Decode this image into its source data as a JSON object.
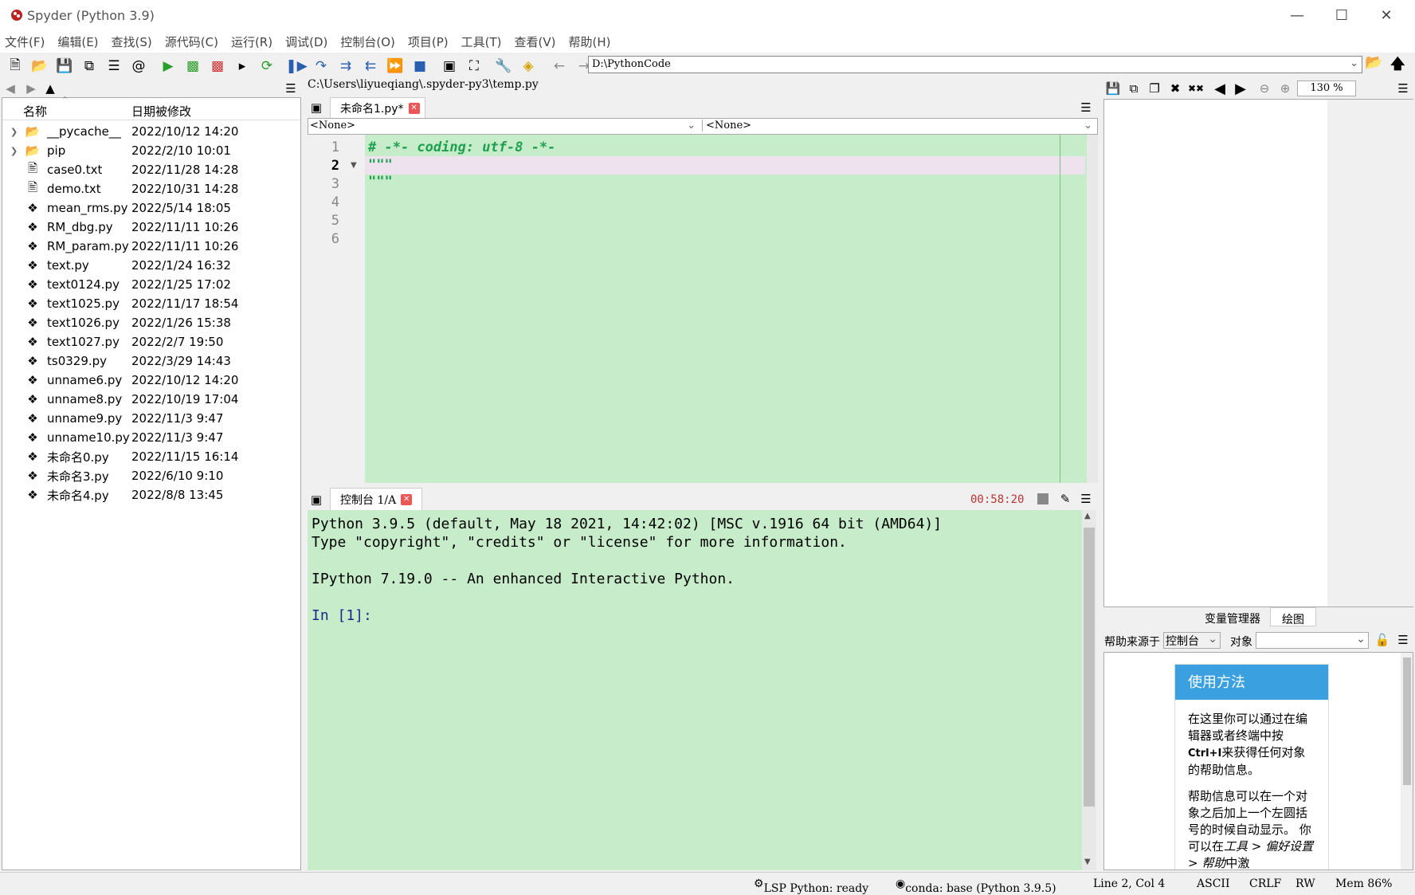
{
  "window": {
    "title": "Spyder (Python 3.9)"
  },
  "menu": [
    "文件(F)",
    "编辑(E)",
    "查找(S)",
    "源代码(C)",
    "运行(R)",
    "调试(D)",
    "控制台(O)",
    "项目(P)",
    "工具(T)",
    "查看(V)",
    "帮助(H)"
  ],
  "toolbar": {
    "path": "D:\\PythonCode"
  },
  "files": {
    "col_name": "名称",
    "col_date": "日期被修改",
    "items": [
      {
        "name": "__pycache__",
        "date": "2022/10/12 14:20",
        "type": "folder"
      },
      {
        "name": "pip",
        "date": "2022/2/10 10:01",
        "type": "folder"
      },
      {
        "name": "case0.txt",
        "date": "2022/11/28 14:28",
        "type": "txt"
      },
      {
        "name": "demo.txt",
        "date": "2022/10/31 14:28",
        "type": "txt"
      },
      {
        "name": "mean_rms.py",
        "date": "2022/5/14 18:05",
        "type": "py"
      },
      {
        "name": "RM_dbg.py",
        "date": "2022/11/11 10:26",
        "type": "py"
      },
      {
        "name": "RM_param.py",
        "date": "2022/11/11 10:26",
        "type": "py"
      },
      {
        "name": "text.py",
        "date": "2022/1/24 16:32",
        "type": "py"
      },
      {
        "name": "text0124.py",
        "date": "2022/1/25 17:02",
        "type": "py"
      },
      {
        "name": "text1025.py",
        "date": "2022/11/17 18:54",
        "type": "py"
      },
      {
        "name": "text1026.py",
        "date": "2022/1/26 15:38",
        "type": "py"
      },
      {
        "name": "text1027.py",
        "date": "2022/2/7 19:50",
        "type": "py"
      },
      {
        "name": "ts0329.py",
        "date": "2022/3/29 14:43",
        "type": "py"
      },
      {
        "name": "unname6.py",
        "date": "2022/10/12 14:20",
        "type": "py"
      },
      {
        "name": "unname8.py",
        "date": "2022/10/19 17:04",
        "type": "py"
      },
      {
        "name": "unname9.py",
        "date": "2022/11/3 9:47",
        "type": "py"
      },
      {
        "name": "unname10.py",
        "date": "2022/11/3 9:47",
        "type": "py"
      },
      {
        "name": "未命名0.py",
        "date": "2022/11/15 16:14",
        "type": "py"
      },
      {
        "name": "未命名3.py",
        "date": "2022/6/10 9:10",
        "type": "py"
      },
      {
        "name": "未命名4.py",
        "date": "2022/8/8 13:45",
        "type": "py"
      }
    ]
  },
  "editor": {
    "file_path": "C:\\Users\\liyueqiang\\.spyder-py3\\temp.py",
    "tab_label": "未命名1.py*",
    "class_combo": "<None>",
    "method_combo": "<None>",
    "line_numbers": [
      "1",
      "2",
      "3",
      "4",
      "5",
      "6"
    ],
    "lines": [
      "# -*- coding: utf-8 -*-",
      "\"\"\"",
      "\"\"\""
    ]
  },
  "console": {
    "tab_label": "控制台 1/A",
    "elapsed": "00:58:20",
    "lines": [
      "Python 3.9.5 (default, May 18 2021, 14:42:02) [MSC v.1916 64 bit (AMD64)]",
      "Type \"copyright\", \"credits\" or \"license\" for more information.",
      "",
      "IPython 7.19.0 -- An enhanced Interactive Python.",
      "",
      "In [1]:"
    ]
  },
  "plots": {
    "zoom": "130 %"
  },
  "right_tabs": {
    "variables": "变量管理器",
    "plots": "绘图"
  },
  "help": {
    "source_label": "帮助来源于",
    "source_value": "控制台",
    "object_label": "对象",
    "card_title": "使用方法",
    "para1_pre": "在这里你可以通过在编辑器或者终端中按",
    "para1_key": "Ctrl+I",
    "para1_post": "来获得任何对象的帮助信息。",
    "para2_pre": "帮助信息可以在一个对象之后加上一个左圆括号的时候自动显示。 你可以在",
    "para2_menu": "工具 > 偏好设置 > 帮助",
    "para2_post": "中激"
  },
  "status": {
    "lsp": "LSP Python: ready",
    "conda": "conda: base (Python 3.9.5)",
    "position": "Line 2, Col 4",
    "encoding": "ASCII",
    "eol": "CRLF",
    "rw": "RW",
    "mem": "Mem 86%"
  },
  "colors": {
    "editor_bg": "#c6ecc9",
    "accent": "#3aa0e0",
    "run_green": "#2a9d2a"
  }
}
